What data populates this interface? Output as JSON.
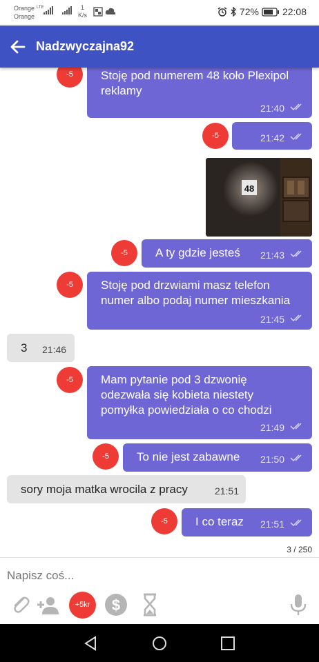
{
  "status_bar": {
    "carrier1": "Orange",
    "carrier2": "Orange",
    "net_label": "LTE",
    "speed_value": "1",
    "speed_unit": "K/s",
    "battery": "72%",
    "time": "22:08"
  },
  "header": {
    "title": "Nadzwyczajna92"
  },
  "messages": [
    {
      "dir": "out",
      "text_lines": [
        "Stoję pod numerem 48 koło Plexipol",
        "reklamy"
      ],
      "time": "21:40",
      "badge": "-5"
    },
    {
      "dir": "out",
      "text_lines": [
        ""
      ],
      "time": "21:42",
      "badge": "-5"
    },
    {
      "dir": "out",
      "type": "image",
      "image_text": "48"
    },
    {
      "dir": "out",
      "text_lines": [
        "A ty gdzie jesteś"
      ],
      "time": "21:43",
      "badge": "-5"
    },
    {
      "dir": "out",
      "text_lines": [
        "Stoję pod drzwiami masz telefon",
        "numer albo podaj numer mieszkania"
      ],
      "time": "21:45",
      "badge": "-5"
    },
    {
      "dir": "in",
      "text_lines": [
        "3"
      ],
      "time": "21:46"
    },
    {
      "dir": "out",
      "text_lines": [
        "Mam pytanie pod 3 dzwonię",
        "odezwała się kobieta niestety",
        "pomyłka powiedziała o co chodzi"
      ],
      "time": "21:49",
      "badge": "-5"
    },
    {
      "dir": "out",
      "text_lines": [
        "To nie jest zabawne"
      ],
      "time": "21:50",
      "badge": "-5"
    },
    {
      "dir": "in",
      "text_lines": [
        "sory moja matka wrocila z pracy"
      ],
      "time": "21:51"
    },
    {
      "dir": "out",
      "text_lines": [
        "I co teraz"
      ],
      "time": "21:51",
      "badge": "-5"
    }
  ],
  "pagination": "3 / 250",
  "composer": {
    "placeholder": "Napisz coś...",
    "money_label": "+5kr"
  },
  "colors": {
    "app_bar": "#3f52c4",
    "out_bubble": "#6e66d4",
    "in_bubble": "#e4e4e4",
    "badge": "#ef3b35"
  }
}
